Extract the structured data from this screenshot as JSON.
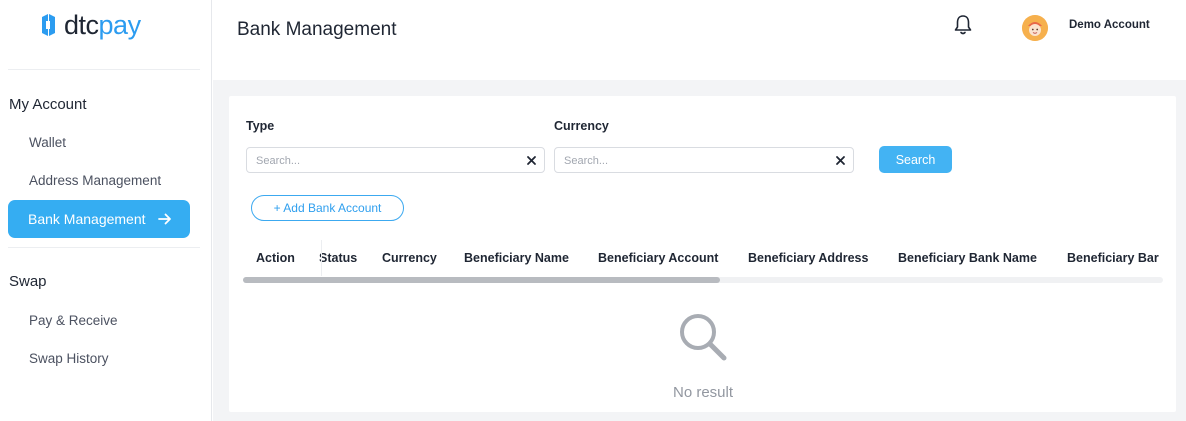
{
  "brand": {
    "logo_text_dark": "dtc",
    "logo_text_accent": "pay",
    "logo_mark": "dtcpay-logo-mark",
    "accent_color": "#35adf2"
  },
  "sidebar": {
    "sections": [
      {
        "title": "My Account",
        "items": [
          "Wallet",
          "Address Management",
          "Bank Management"
        ]
      },
      {
        "title": "Swap",
        "items": [
          "Pay & Receive",
          "Swap History"
        ]
      }
    ],
    "active_item": "Bank Management"
  },
  "header": {
    "title": "Bank Management",
    "user_name": "Demo Account",
    "notification_icon": "bell-icon"
  },
  "filters": {
    "type_label": "Type",
    "type_placeholder": "Search...",
    "type_value": "",
    "currency_label": "Currency",
    "currency_placeholder": "Search...",
    "currency_value": "",
    "search_button": "Search"
  },
  "actions": {
    "add_bank_account": "+ Add Bank Account"
  },
  "table": {
    "columns": [
      "Action",
      "Status",
      "Currency",
      "Beneficiary Name",
      "Beneficiary Account",
      "Beneficiary Address",
      "Beneficiary Bank Name",
      "Beneficiary Bar"
    ],
    "rows": [],
    "empty_text": "No result"
  }
}
